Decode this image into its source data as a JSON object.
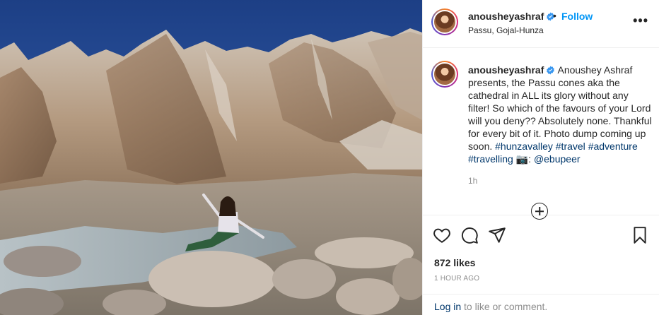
{
  "header": {
    "username": "anousheyashraf",
    "separator": "•",
    "follow_label": "Follow",
    "location": "Passu, Gojal-Hunza",
    "more_label": "•••"
  },
  "caption": {
    "username": "anousheyashraf",
    "text_before_tags": "Anoushey Ashraf presents, the Passu cones aka the cathedral in ALL its glory without any filter! So which of the favours of your Lord will you deny?? Absolutely none. Thankful for every bit of it. Photo dump coming up soon.",
    "tags": [
      "#hunzavalley",
      "#travel",
      "#adventure",
      "#travelling"
    ],
    "camera_emoji": "📷",
    "colon": ":",
    "mention": "@ebupeer",
    "time": "1h"
  },
  "stats": {
    "likes": "872 likes",
    "posted_ago": "1 HOUR AGO"
  },
  "footer": {
    "login_link": "Log in",
    "login_rest": " to like or comment."
  },
  "icons": {
    "verified": "verified-badge-icon",
    "like": "heart-icon",
    "comment": "comment-bubble-icon",
    "share": "paper-plane-icon",
    "save": "bookmark-icon",
    "load_more": "plus-circle-icon"
  },
  "colors": {
    "link_blue": "#0095f6",
    "hashtag": "#00376b",
    "muted": "#8e8e8e",
    "text": "#262626"
  }
}
